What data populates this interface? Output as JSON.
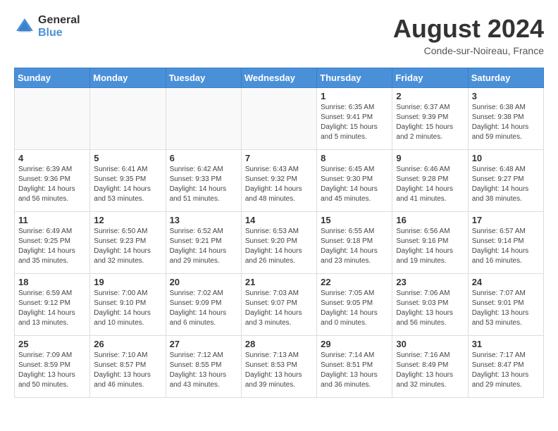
{
  "logo": {
    "text_general": "General",
    "text_blue": "Blue"
  },
  "title": {
    "month_year": "August 2024",
    "location": "Conde-sur-Noireau, France"
  },
  "headers": [
    "Sunday",
    "Monday",
    "Tuesday",
    "Wednesday",
    "Thursday",
    "Friday",
    "Saturday"
  ],
  "weeks": [
    [
      {
        "date": "",
        "info": ""
      },
      {
        "date": "",
        "info": ""
      },
      {
        "date": "",
        "info": ""
      },
      {
        "date": "",
        "info": ""
      },
      {
        "date": "1",
        "info": "Sunrise: 6:35 AM\nSunset: 9:41 PM\nDaylight: 15 hours\nand 5 minutes."
      },
      {
        "date": "2",
        "info": "Sunrise: 6:37 AM\nSunset: 9:39 PM\nDaylight: 15 hours\nand 2 minutes."
      },
      {
        "date": "3",
        "info": "Sunrise: 6:38 AM\nSunset: 9:38 PM\nDaylight: 14 hours\nand 59 minutes."
      }
    ],
    [
      {
        "date": "4",
        "info": "Sunrise: 6:39 AM\nSunset: 9:36 PM\nDaylight: 14 hours\nand 56 minutes."
      },
      {
        "date": "5",
        "info": "Sunrise: 6:41 AM\nSunset: 9:35 PM\nDaylight: 14 hours\nand 53 minutes."
      },
      {
        "date": "6",
        "info": "Sunrise: 6:42 AM\nSunset: 9:33 PM\nDaylight: 14 hours\nand 51 minutes."
      },
      {
        "date": "7",
        "info": "Sunrise: 6:43 AM\nSunset: 9:32 PM\nDaylight: 14 hours\nand 48 minutes."
      },
      {
        "date": "8",
        "info": "Sunrise: 6:45 AM\nSunset: 9:30 PM\nDaylight: 14 hours\nand 45 minutes."
      },
      {
        "date": "9",
        "info": "Sunrise: 6:46 AM\nSunset: 9:28 PM\nDaylight: 14 hours\nand 41 minutes."
      },
      {
        "date": "10",
        "info": "Sunrise: 6:48 AM\nSunset: 9:27 PM\nDaylight: 14 hours\nand 38 minutes."
      }
    ],
    [
      {
        "date": "11",
        "info": "Sunrise: 6:49 AM\nSunset: 9:25 PM\nDaylight: 14 hours\nand 35 minutes."
      },
      {
        "date": "12",
        "info": "Sunrise: 6:50 AM\nSunset: 9:23 PM\nDaylight: 14 hours\nand 32 minutes."
      },
      {
        "date": "13",
        "info": "Sunrise: 6:52 AM\nSunset: 9:21 PM\nDaylight: 14 hours\nand 29 minutes."
      },
      {
        "date": "14",
        "info": "Sunrise: 6:53 AM\nSunset: 9:20 PM\nDaylight: 14 hours\nand 26 minutes."
      },
      {
        "date": "15",
        "info": "Sunrise: 6:55 AM\nSunset: 9:18 PM\nDaylight: 14 hours\nand 23 minutes."
      },
      {
        "date": "16",
        "info": "Sunrise: 6:56 AM\nSunset: 9:16 PM\nDaylight: 14 hours\nand 19 minutes."
      },
      {
        "date": "17",
        "info": "Sunrise: 6:57 AM\nSunset: 9:14 PM\nDaylight: 14 hours\nand 16 minutes."
      }
    ],
    [
      {
        "date": "18",
        "info": "Sunrise: 6:59 AM\nSunset: 9:12 PM\nDaylight: 14 hours\nand 13 minutes."
      },
      {
        "date": "19",
        "info": "Sunrise: 7:00 AM\nSunset: 9:10 PM\nDaylight: 14 hours\nand 10 minutes."
      },
      {
        "date": "20",
        "info": "Sunrise: 7:02 AM\nSunset: 9:09 PM\nDaylight: 14 hours\nand 6 minutes."
      },
      {
        "date": "21",
        "info": "Sunrise: 7:03 AM\nSunset: 9:07 PM\nDaylight: 14 hours\nand 3 minutes."
      },
      {
        "date": "22",
        "info": "Sunrise: 7:05 AM\nSunset: 9:05 PM\nDaylight: 14 hours\nand 0 minutes."
      },
      {
        "date": "23",
        "info": "Sunrise: 7:06 AM\nSunset: 9:03 PM\nDaylight: 13 hours\nand 56 minutes."
      },
      {
        "date": "24",
        "info": "Sunrise: 7:07 AM\nSunset: 9:01 PM\nDaylight: 13 hours\nand 53 minutes."
      }
    ],
    [
      {
        "date": "25",
        "info": "Sunrise: 7:09 AM\nSunset: 8:59 PM\nDaylight: 13 hours\nand 50 minutes."
      },
      {
        "date": "26",
        "info": "Sunrise: 7:10 AM\nSunset: 8:57 PM\nDaylight: 13 hours\nand 46 minutes."
      },
      {
        "date": "27",
        "info": "Sunrise: 7:12 AM\nSunset: 8:55 PM\nDaylight: 13 hours\nand 43 minutes."
      },
      {
        "date": "28",
        "info": "Sunrise: 7:13 AM\nSunset: 8:53 PM\nDaylight: 13 hours\nand 39 minutes."
      },
      {
        "date": "29",
        "info": "Sunrise: 7:14 AM\nSunset: 8:51 PM\nDaylight: 13 hours\nand 36 minutes."
      },
      {
        "date": "30",
        "info": "Sunrise: 7:16 AM\nSunset: 8:49 PM\nDaylight: 13 hours\nand 32 minutes."
      },
      {
        "date": "31",
        "info": "Sunrise: 7:17 AM\nSunset: 8:47 PM\nDaylight: 13 hours\nand 29 minutes."
      }
    ]
  ]
}
